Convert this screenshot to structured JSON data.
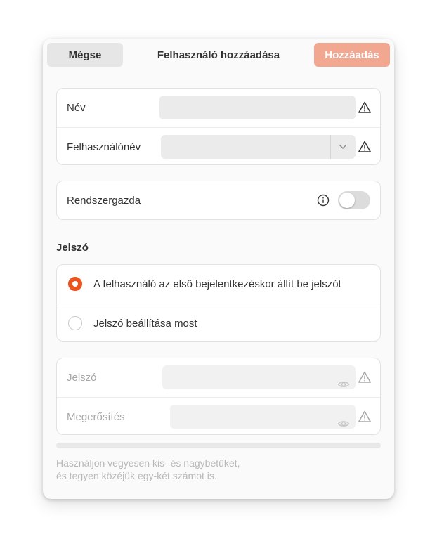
{
  "header": {
    "cancel_label": "Mégse",
    "title": "Felhasználó hozzáadása",
    "add_label": "Hozzáadás"
  },
  "identity": {
    "name_label": "Név",
    "name_value": "",
    "username_label": "Felhasználónév",
    "username_value": ""
  },
  "admin": {
    "label": "Rendszergazda",
    "enabled": false
  },
  "password_section": {
    "title": "Jelszó",
    "options": [
      {
        "label": "A felhasználó az első bejelentkezéskor állít be jelszót",
        "selected": true
      },
      {
        "label": "Jelszó beállítása most",
        "selected": false
      }
    ]
  },
  "password_fields": {
    "password_label": "Jelszó",
    "password_value": "",
    "confirm_label": "Megerősítés",
    "confirm_value": ""
  },
  "hint": {
    "line1": "Használjon vegyesen kis- és nagybetűket,",
    "line2": "és tegyen közéjük egy-két számot is."
  },
  "colors": {
    "accent": "#e95420",
    "add_button_disabled": "#f2a791"
  },
  "icons": [
    "warning-icon",
    "chevron-down-icon",
    "info-icon",
    "eye-icon"
  ]
}
